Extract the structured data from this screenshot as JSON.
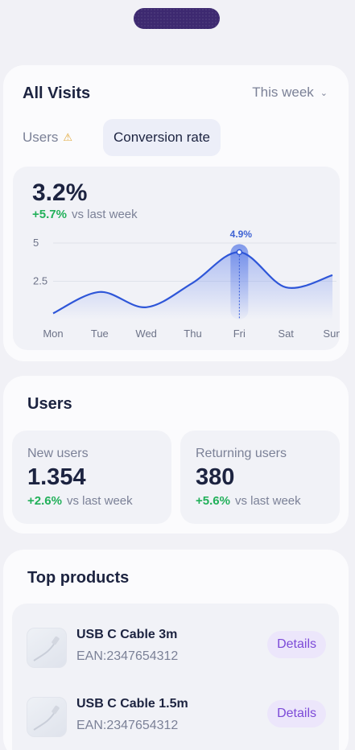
{
  "visits": {
    "title": "All Visits",
    "period": "This week",
    "tabs": {
      "users": "Users",
      "conversion": "Conversion rate"
    },
    "value": "3.2%",
    "delta": "+5.7%",
    "delta_suffix": "vs last week",
    "peak_label": "4.9%"
  },
  "chart_data": {
    "type": "line",
    "categories": [
      "Mon",
      "Tue",
      "Wed",
      "Thu",
      "Fri",
      "Sat",
      "Sun"
    ],
    "series": [
      {
        "values": [
          0.4,
          1.8,
          0.8,
          2.4,
          4.4,
          2.1,
          2.9
        ]
      }
    ],
    "y_ticks": [
      "5",
      "2.5"
    ],
    "ylim": [
      0,
      5
    ],
    "highlight_index": 4,
    "line_color": "#2e56d8",
    "fill_color": "#7d97ee"
  },
  "users": {
    "title": "Users",
    "new": {
      "label": "New users",
      "value": "1.354",
      "delta": "+2.6%",
      "suffix": "vs last week"
    },
    "returning": {
      "label": "Returning users",
      "value": "380",
      "delta": "+5.6%",
      "suffix": "vs last week"
    }
  },
  "products": {
    "title": "Top products",
    "items": [
      {
        "name": "USB C Cable 3m",
        "ean": "EAN:2347654312",
        "action": "Details"
      },
      {
        "name": "USB C Cable 1.5m",
        "ean": "EAN:2347654312",
        "action": "Details"
      }
    ]
  }
}
